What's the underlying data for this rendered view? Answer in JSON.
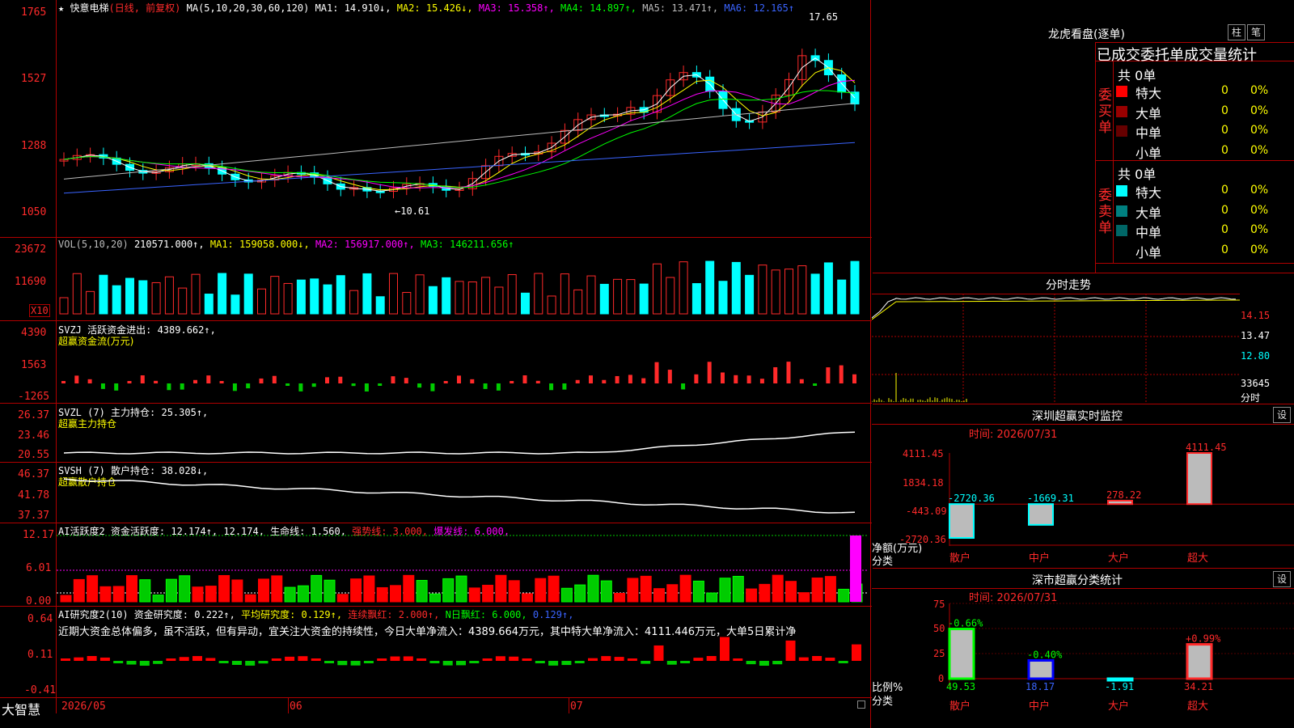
{
  "stock": {
    "star": "★",
    "name": "快意电梯",
    "period": "(日线, 前复权)",
    "ma_params": "MA(5,10,20,30,60,120)",
    "ma1": "MA1: 14.910↓,",
    "ma2": "MA2: 15.426↓,",
    "ma3": "MA3: 15.358↑,",
    "ma4": "MA4: 14.897↑,",
    "ma5": "MA5: 13.471↑,",
    "ma6": "MA6: 12.165↑",
    "high_mark": "17.65",
    "low_mark": "←10.61",
    "y_labels": [
      "1765",
      "1527",
      "1288",
      "1050"
    ]
  },
  "vol": {
    "label": "VOL(5,10,20)",
    "value": "210571.000↑,",
    "ma1": "MA1: 159058.000↓,",
    "ma2": "MA2: 156917.000↑,",
    "ma3": "MA3: 146211.656↑",
    "y_labels": [
      "23672",
      "11690"
    ],
    "unit": "X10"
  },
  "svzj": {
    "label": "SVZJ  活跃资金进出: 4389.662↑,",
    "sub": "超赢资金流(万元)",
    "y_labels": [
      "4390",
      "1563",
      "-1265"
    ]
  },
  "svzl": {
    "label": "SVZL (7) 主力持仓: 25.305↑,",
    "sub": "超赢主力持仓",
    "y_labels": [
      "26.37",
      "23.46",
      "20.55"
    ]
  },
  "svsh": {
    "label": "SVSH (7) 散户持仓: 38.028↓,",
    "sub": "超赢散户持仓",
    "y_labels": [
      "46.37",
      "41.78",
      "37.37"
    ]
  },
  "ai_act": {
    "label": "AI活跃度2 资金活跃度: 12.174↑, 12.174, 生命线: 1.560,",
    "strong": "强势线: 3.000,",
    "burst": "爆发线: 6.000,",
    "y_labels": [
      "12.17",
      "6.01",
      "0.00"
    ]
  },
  "ai_res": {
    "label": "AI研究度2(10) 资金研究度: 0.222↑,",
    "avg": "平均研究度: 0.129↑,",
    "cont": "连续飘红: 2.000↑,",
    "nday": "N日飘红: 6.000,",
    "last": "0.129↑,",
    "desc": "近期大资金总体偏多，虽不活跃，但有异动，宜关注大资金的持续性，今日大单净流入：4389.664万元，其中特大单净流入：4111.446万元，大单5日累计净",
    "y_labels": [
      "0.64",
      "0.11",
      "-0.41"
    ]
  },
  "bottom": {
    "brand": "大智慧",
    "dates": [
      "2026/05",
      "06",
      "07"
    ]
  },
  "longhu": {
    "title": "龙虎看盘(逐单)",
    "btn1": "柱",
    "btn2": "笔",
    "header": "已成交委托单成交量统计",
    "buy_label": "委买单",
    "sell_label": "委卖单",
    "buy_total": "共 0单",
    "sell_total": "共 0单",
    "buy_rows": [
      {
        "name": "特大",
        "count": "0",
        "pct": "0%",
        "color": "#ff0000"
      },
      {
        "name": "大单",
        "count": "0",
        "pct": "0%",
        "color": "#990000"
      },
      {
        "name": "中单",
        "count": "0",
        "pct": "0%",
        "color": "#660000"
      },
      {
        "name": "小单",
        "count": "0",
        "pct": "0%",
        "color": "#000000"
      }
    ],
    "sell_rows": [
      {
        "name": "特大",
        "count": "0",
        "pct": "0%",
        "color": "#00ffff"
      },
      {
        "name": "大单",
        "count": "0",
        "pct": "0%",
        "color": "#008080"
      },
      {
        "name": "中单",
        "count": "0",
        "pct": "0%",
        "color": "#006666"
      },
      {
        "name": "小单",
        "count": "0",
        "pct": "0%",
        "color": "#000000"
      }
    ]
  },
  "intraday": {
    "title": "分时走势",
    "y_labels": [
      "14.15",
      "13.47",
      "12.80",
      "33645"
    ],
    "unit": "分时"
  },
  "sz_monitor": {
    "title": "深圳超赢实时监控",
    "btn": "设",
    "time": "时间: 2026/07/31",
    "y_labels": [
      "4111.45",
      "1834.18",
      "-443.09",
      "-2720.36"
    ],
    "unit1": "净额(万元)",
    "unit2": "分类",
    "categories": [
      "散户",
      "中户",
      "大户",
      "超大"
    ],
    "values": [
      -2720.36,
      -1669.31,
      278.22,
      4111.45
    ],
    "value_labels": [
      "-2720.36",
      "-1669.31",
      "278.22",
      "4111.45"
    ]
  },
  "sz_stats": {
    "title": "深市超赢分类统计",
    "btn": "设",
    "time": "时间: 2026/07/31",
    "y_labels": [
      "75",
      "50",
      "25",
      "0"
    ],
    "unit1": "比例%",
    "unit2": "分类",
    "categories": [
      "散户",
      "中户",
      "大户",
      "超大"
    ],
    "values": [
      49.53,
      18.17,
      -1.91,
      34.21
    ],
    "value_labels": [
      "49.53",
      "18.17",
      "-1.91",
      "34.21"
    ],
    "changes": [
      "-0.66%",
      "-0.40%",
      "",
      "+0.99%"
    ]
  },
  "colors": {
    "up": "#ff2a2a",
    "down": "#00ffff",
    "grid": "#b00000"
  }
}
